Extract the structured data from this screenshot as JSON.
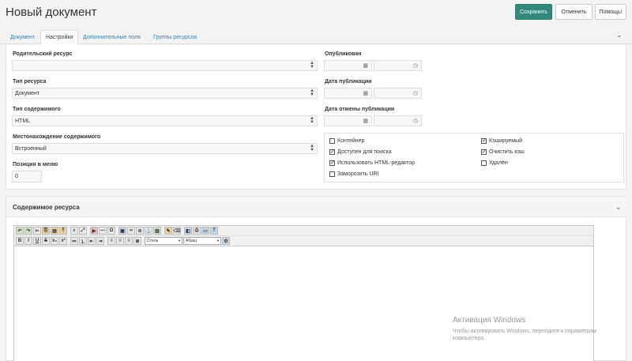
{
  "header": {
    "title": "Новый документ",
    "save_label": "Сохранить",
    "cancel_label": "Отменить",
    "help_label": "Помощь!"
  },
  "tabs": [
    {
      "label": "Документ",
      "active": false
    },
    {
      "label": "Настройки",
      "active": true
    },
    {
      "label": "Дополнительные поля",
      "active": false
    },
    {
      "label": "Группы ресурсов",
      "active": false
    }
  ],
  "settings": {
    "parent_label": "Родительский ресурс",
    "parent_value": "",
    "type_label": "Тип ресурса",
    "type_value": "Документ",
    "content_type_label": "Тип содержимого",
    "content_type_value": "HTML",
    "location_label": "Местонахождение содержимого",
    "location_value": "Встроенный",
    "menu_pos_label": "Позиция в меню",
    "menu_pos_value": "0",
    "published_label": "Опубликован",
    "pub_date_label": "Дата публикации",
    "unpub_date_label": "Дата отмены публикации"
  },
  "checkboxes": [
    {
      "label": "Контейнер",
      "checked": false
    },
    {
      "label": "Доступен для поиска",
      "checked": true
    },
    {
      "label": "Использовать HTML-редактор",
      "checked": true
    },
    {
      "label": "Заморозить URI",
      "checked": false
    },
    {
      "label": "Кэшируемый",
      "checked": true
    },
    {
      "label": "Очистить кэш",
      "checked": true
    },
    {
      "label": "Удалён",
      "checked": false
    }
  ],
  "content_section": {
    "title": "Содержимое ресурса",
    "toolbar_style": "Стиль",
    "toolbar_format": "Абзац"
  },
  "watermark": {
    "title": "Активация Windows",
    "subtitle": "Чтобы активировать Windows, перейдите к параметрам компьютера."
  },
  "icons": {
    "calendar": "calendar-icon",
    "clock": "clock-icon",
    "chevron": "chevron-down-icon",
    "select_arrows": "select-arrows-icon"
  },
  "colors": {
    "accent": "#34887c",
    "link": "#3a7fb0"
  }
}
